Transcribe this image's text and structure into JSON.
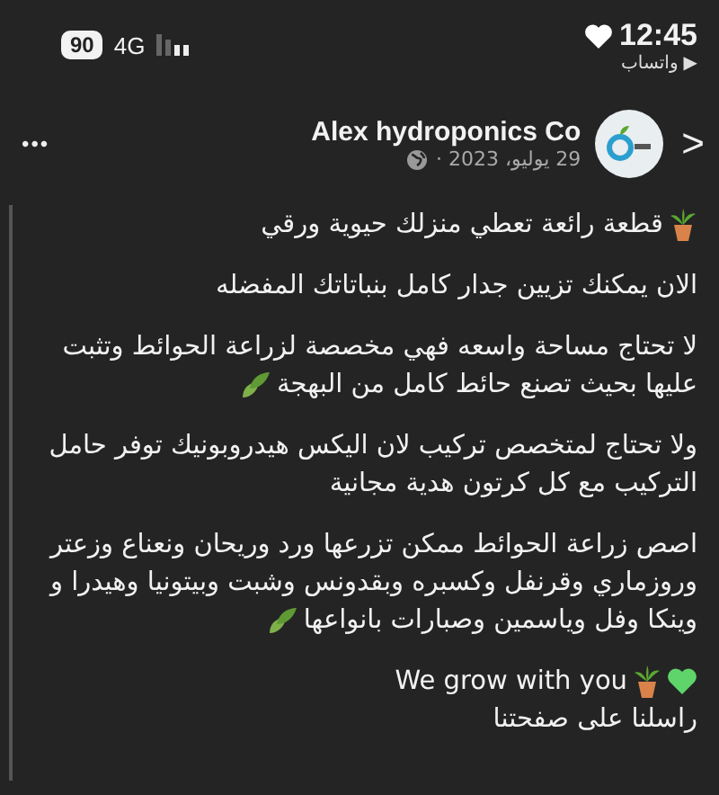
{
  "status_bar": {
    "time": "12:45",
    "back_app": "واتساب",
    "back_arrow": "▶",
    "battery": "90",
    "network": "4G"
  },
  "post": {
    "author": "Alex hydroponics Co",
    "date": "29 يوليو، 2023 ·",
    "more": "•••",
    "next": ">",
    "paragraphs": [
      {
        "lines": [
          [
            {
              "kind": "plant"
            },
            {
              "kind": "text",
              "text": "قطعة رائعة تعطي منزلك حيوية ورقي"
            }
          ]
        ]
      },
      {
        "lines": [
          [
            {
              "kind": "text",
              "text": "الان يمكنك تزيين جدار كامل بنباتاتك المفضله"
            }
          ]
        ]
      },
      {
        "lines": [
          [
            {
              "kind": "text",
              "text": "لا تحتاج مساحة واسعه فهي مخصصة لزراعة الحوائط وتثبت"
            }
          ],
          [
            {
              "kind": "text",
              "text": "عليها بحيث تصنع حائط كامل من البهجة"
            },
            {
              "kind": "leaves"
            }
          ]
        ]
      },
      {
        "lines": [
          [
            {
              "kind": "text",
              "text": "ولا تحتاج لمتخصص تركيب لان اليكس هيدروبونيك توفر حامل"
            }
          ],
          [
            {
              "kind": "text",
              "text": "التركيب مع كل كرتون هدية مجانية"
            }
          ]
        ]
      },
      {
        "lines": [
          [
            {
              "kind": "text",
              "text": "اصص زراعة الحوائط ممكن تزرعها ورد وريحان ونعناع وزعتر"
            }
          ],
          [
            {
              "kind": "text",
              "text": "وروزماري وقرنفل وكسبره وبقدونس وشبت وبيتونيا وهيدرا و"
            }
          ],
          [
            {
              "kind": "text",
              "text": "وينكا وفل وياسمين وصبارات بانواعها"
            },
            {
              "kind": "leaves"
            }
          ]
        ]
      },
      {
        "lines": [
          [
            {
              "kind": "heart"
            },
            {
              "kind": "plant"
            },
            {
              "kind": "text",
              "text": "We grow with you"
            }
          ],
          [
            {
              "kind": "text",
              "text": "راسلنا  على صفحتنا"
            }
          ]
        ]
      }
    ]
  }
}
